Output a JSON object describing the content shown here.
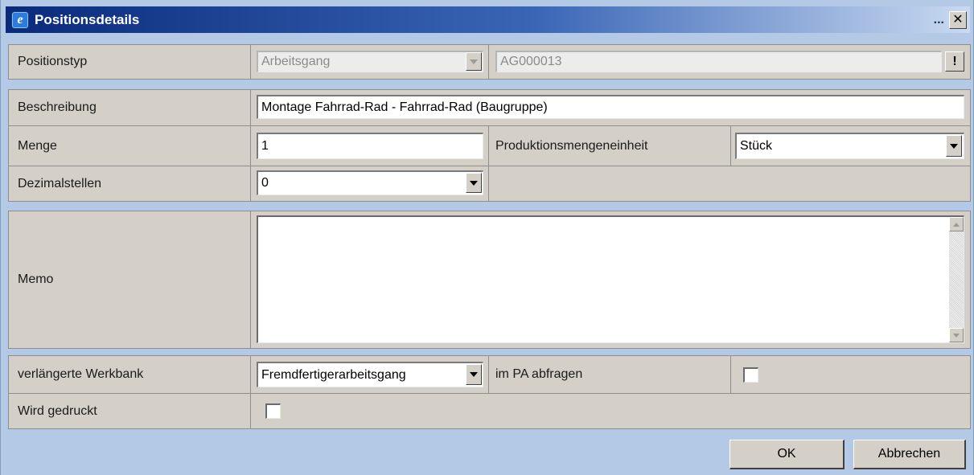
{
  "window": {
    "title": "Positionsdetails",
    "ellipsis": "...",
    "close_glyph": "✕",
    "icon": "internet-explorer-icon"
  },
  "rows": {
    "positionstyp": {
      "label": "Positionstyp",
      "select_value": "Arbeitsgang",
      "code_value": "AG000013",
      "lookup_button_label": "!"
    },
    "beschreibung": {
      "label": "Beschreibung",
      "value": "Montage Fahrrad-Rad - Fahrrad-Rad (Baugruppe)"
    },
    "menge": {
      "label": "Menge",
      "value": "1",
      "unit_label": "Produktionsmengeneinheit",
      "unit_value": "Stück"
    },
    "dezimalstellen": {
      "label": "Dezimalstellen",
      "value": "0"
    },
    "memo": {
      "label": "Memo",
      "value": ""
    },
    "werkbank": {
      "label": "verlängerte Werkbank",
      "value": "Fremdfertigerarbeitsgang",
      "pa_label": "im PA abfragen",
      "pa_checked": false
    },
    "gedruckt": {
      "label": "Wird gedruckt",
      "checked": false
    }
  },
  "buttons": {
    "ok": "OK",
    "cancel": "Abbrechen"
  },
  "colors": {
    "frame_blue": "#b4c9e6",
    "title_dark": "#0a2a7a",
    "panel_gray": "#d4d0c8"
  }
}
